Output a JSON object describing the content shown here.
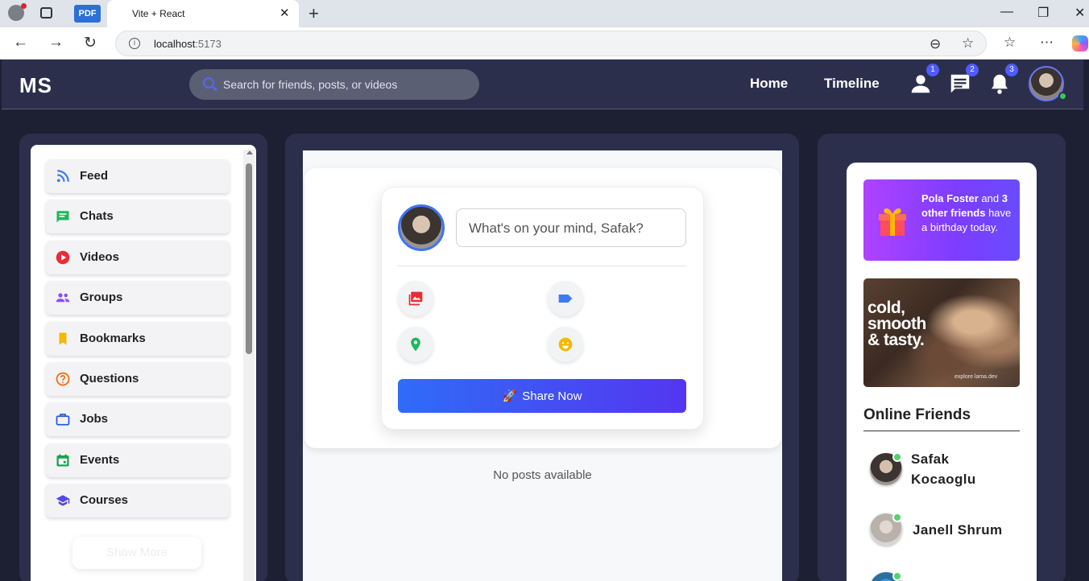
{
  "browser": {
    "pdf_tab": "PDF",
    "tab_title": "Vite + React",
    "tab_close": "✕",
    "new_tab": "+",
    "url_host": "localhost",
    "url_port": ":5173"
  },
  "header": {
    "logo": "MS",
    "search_placeholder": "Search for friends, posts, or videos",
    "nav_home": "Home",
    "nav_timeline": "Timeline",
    "badge_friends": "1",
    "badge_messages": "2",
    "badge_notifications": "3"
  },
  "sidebar": {
    "items": [
      {
        "label": "Feed",
        "icon": "rss-icon",
        "color": "#3d7bf5"
      },
      {
        "label": "Chats",
        "icon": "chat-icon",
        "color": "#1fb85a"
      },
      {
        "label": "Videos",
        "icon": "play-icon",
        "color": "#ea2b35"
      },
      {
        "label": "Groups",
        "icon": "group-icon",
        "color": "#8a4dfa"
      },
      {
        "label": "Bookmarks",
        "icon": "bookmark-icon",
        "color": "#f5b800"
      },
      {
        "label": "Questions",
        "icon": "question-icon",
        "color": "#f2711c"
      },
      {
        "label": "Jobs",
        "icon": "briefcase-icon",
        "color": "#2458e8"
      },
      {
        "label": "Events",
        "icon": "calendar-icon",
        "color": "#19a24c"
      },
      {
        "label": "Courses",
        "icon": "graduation-cap-icon",
        "color": "#5548e6"
      }
    ],
    "show_more": "Show More"
  },
  "share": {
    "placeholder": "What's on your mind, Safak?",
    "button": "Share Now",
    "rocket": "🚀"
  },
  "feed": {
    "empty": "No posts available"
  },
  "rightbar": {
    "bday_name": "Pola Foster",
    "bday_and": " and ",
    "bday_others": "3 other friends",
    "bday_rest": " have a birthday today.",
    "ad_line1": "cold,",
    "ad_line2": "smooth",
    "ad_line3": "& tasty.",
    "ad_small": "explore lama.dev",
    "online_title": "Online Friends",
    "friends": [
      {
        "name_line1": "Safak",
        "name_line2": "Kocaoglu"
      },
      {
        "name_line1": "Janell Shrum"
      }
    ]
  },
  "colors": {
    "header_bg": "#2b2f4c",
    "page_bg": "#1d2033",
    "accent": "#4f5bff",
    "online": "#53d36b"
  }
}
